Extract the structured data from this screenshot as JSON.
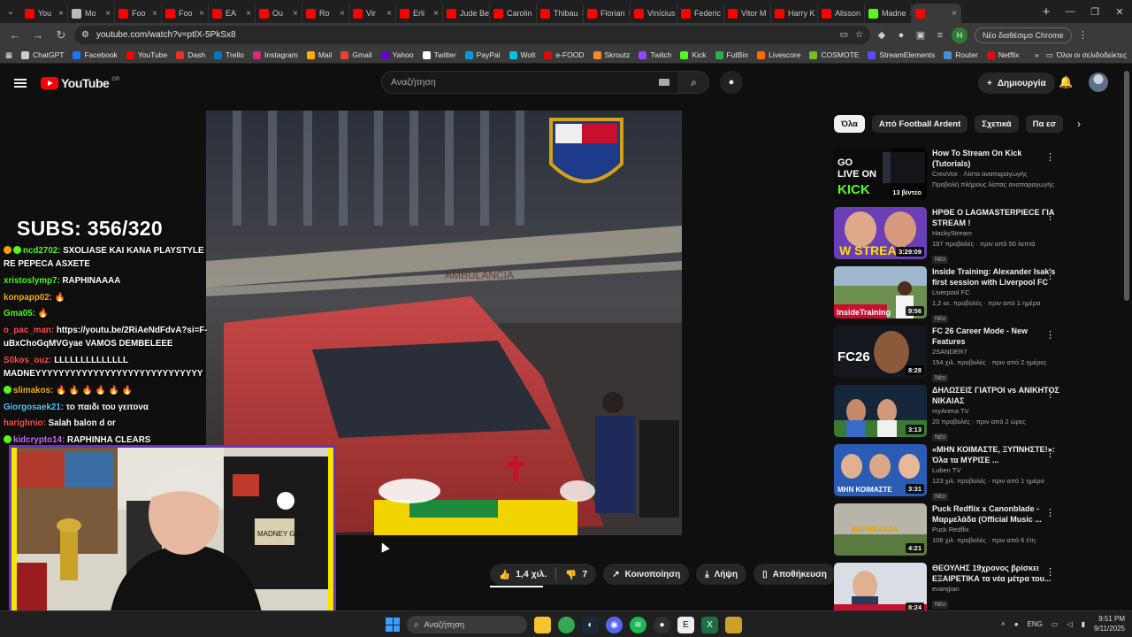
{
  "browser": {
    "tabs": [
      {
        "label": "You",
        "color": "#ff0000",
        "active": false
      },
      {
        "label": "Mo",
        "color": "#bbbbbb",
        "active": false
      },
      {
        "label": "Foo",
        "color": "#ff0000",
        "active": false
      },
      {
        "label": "Foo",
        "color": "#ff0000",
        "active": false
      },
      {
        "label": "EA",
        "color": "#ff0000",
        "active": false
      },
      {
        "label": "Ou",
        "color": "#ff0000",
        "active": false
      },
      {
        "label": "Ro",
        "color": "#ff0000",
        "active": false
      },
      {
        "label": "Vir",
        "color": "#ff0000",
        "active": false
      },
      {
        "label": "Erli",
        "color": "#ff0000",
        "active": false
      },
      {
        "label": "Jude Be",
        "color": "#ff0000",
        "active": false
      },
      {
        "label": "Carolin",
        "color": "#ff0000",
        "active": false
      },
      {
        "label": "Thibau",
        "color": "#ff0000",
        "active": false
      },
      {
        "label": "Florian",
        "color": "#ff0000",
        "active": false
      },
      {
        "label": "Vinícius",
        "color": "#ff0000",
        "active": false
      },
      {
        "label": "Federic",
        "color": "#ff0000",
        "active": false
      },
      {
        "label": "Vitor M",
        "color": "#ff0000",
        "active": false
      },
      {
        "label": "Harry K",
        "color": "#ff0000",
        "active": false
      },
      {
        "label": "Alisson",
        "color": "#ff0000",
        "active": false
      },
      {
        "label": "Madne",
        "color": "#53fc18",
        "active": false
      },
      {
        "label": "",
        "color": "#ff0000",
        "active": true
      }
    ],
    "url": "youtube.com/watch?v=ptlX-5PkSx8",
    "profile_label": "Νέο διαθέσιμο Chrome",
    "bookmarks": [
      {
        "label": "ChatGPT",
        "color": "#cccccc"
      },
      {
        "label": "Facebook",
        "color": "#1877f2"
      },
      {
        "label": "YouTube",
        "color": "#ff0000"
      },
      {
        "label": "Dash",
        "color": "#e5322d"
      },
      {
        "label": "Trello",
        "color": "#0079bf"
      },
      {
        "label": "Instagram",
        "color": "#d62976"
      },
      {
        "label": "Mail",
        "color": "#ffb000"
      },
      {
        "label": "Gmail",
        "color": "#ea4335"
      },
      {
        "label": "Yahoo",
        "color": "#6001d2"
      },
      {
        "label": "Twitter",
        "color": "#ffffff"
      },
      {
        "label": "PayPal",
        "color": "#009cde"
      },
      {
        "label": "Wolt",
        "color": "#00c2e8"
      },
      {
        "label": "e-FOOD",
        "color": "#e30613"
      },
      {
        "label": "Skroutz",
        "color": "#f68b24"
      },
      {
        "label": "Twitch",
        "color": "#9146ff"
      },
      {
        "label": "Kick",
        "color": "#53fc18"
      },
      {
        "label": "FutBin",
        "color": "#2ab24c"
      },
      {
        "label": "Livescore",
        "color": "#ff6b00"
      },
      {
        "label": "COSMOTE",
        "color": "#78be20"
      },
      {
        "label": "StreamElements",
        "color": "#5b4bff"
      },
      {
        "label": "Router",
        "color": "#4a90d9"
      },
      {
        "label": "Netflix",
        "color": "#e50914"
      }
    ],
    "all_bookmarks_label": "Όλοι οι σελιδοδείκτες"
  },
  "youtube": {
    "logo_text": "YouTube",
    "region": "GR",
    "search_placeholder": "Αναζήτηση",
    "create_label": "Δημιουργία"
  },
  "overlay": {
    "subs": "SUBS: 356/320",
    "chat": [
      {
        "user": "ncd2702:",
        "color": "#53fc18",
        "msg": "SXOLIASE KAI KANA PLAYSTYLE RE PEPECA ASXETE",
        "icons": [
          "#f4a300",
          "#53fc18"
        ]
      },
      {
        "user": "xristoslymp7:",
        "color": "#53fc18",
        "msg": "RAPHINAAAA",
        "icons": []
      },
      {
        "user": "konpapp02:",
        "color": "#f4b400",
        "msg": "🔥",
        "icons": []
      },
      {
        "user": "Gma05:",
        "color": "#53fc18",
        "msg": "🔥",
        "icons": []
      },
      {
        "user": "o_pac_man:",
        "color": "#ff4d4d",
        "msg": "https://youtu.be/2RiAeNdFdvA?si=F-uBxChoGqMVGyae VAMOS DEMBELEEE",
        "icons": []
      },
      {
        "user": "S0kos_ouz:",
        "color": "#ff4d4d",
        "msg": "LLLLLLLLLLLLLL MADNEYYYYYYYYYYYYYYYYYYYYYYYYYYYYY",
        "icons": []
      },
      {
        "user": "slimakos:",
        "color": "#f4b400",
        "msg": "🔥 🔥 🔥 🔥 🔥 🔥",
        "icons": [
          "#53fc18"
        ]
      },
      {
        "user": "Giorgosaek21:",
        "color": "#53c8fc",
        "msg": "το παιδι του γειτονα",
        "icons": []
      },
      {
        "user": "harighnio:",
        "color": "#ff4d4d",
        "msg": "Salah balon d or",
        "icons": []
      },
      {
        "user": "kidcrypto14:",
        "color": "#c86bfc",
        "msg": "RAPHINHA CLEARS",
        "icons": [
          "#53fc18"
        ]
      }
    ]
  },
  "actions": {
    "likes": "1,4 χιλ.",
    "dislikes": "7",
    "share": "Κοινοποίηση",
    "download": "Λήψη",
    "save": "Αποθήκευση"
  },
  "chips": [
    "Όλα",
    "Από Football Ardent",
    "Σχετικά",
    "Πα εσ"
  ],
  "recommendations": [
    {
      "title": "How To Stream On Kick (Tutorials)",
      "channel": "CreoVox · Λίστα αναπαραγωγής",
      "meta": "Προβολή πλήρους λίστας αναπαραγωγής",
      "duration": "13 βίντεο",
      "badge": "",
      "thumb": "kick"
    },
    {
      "title": "ΗΡΘΕ Ο LAGMASTERPIECE ΓΙΑ STREAM !",
      "channel": "HackyStream",
      "meta": "197 προβολές · πριν από 50 λεπτά",
      "duration": "3:29:09",
      "badge": "Νέο",
      "thumb": "stream"
    },
    {
      "title": "Inside Training: Alexander Isak's first session with Liverpool FC",
      "channel": "Liverpool FC",
      "meta": "1,2 εκ. προβολές · πριν από 1 ημέρα",
      "duration": "9:56",
      "badge": "Νέο",
      "thumb": "training"
    },
    {
      "title": "FC 26 Career Mode - New Features",
      "channel": "2SANDER7",
      "meta": "154 χιλ. προβολές · πριν από 2 ημέρες",
      "duration": "8:28",
      "badge": "Νέο",
      "thumb": "fc26"
    },
    {
      "title": "ΔΗΛΩΣΕΙΣ ΓΙΑΤΡΟΙ vs ΑΝΙΚΗΤΟΣ ΝΙΚΑΙΑΣ",
      "channel": "myArena TV",
      "meta": "20 προβολές · πριν από 2 ώρες",
      "duration": "3:13",
      "badge": "Νέο",
      "thumb": "pitch"
    },
    {
      "title": "«ΜΗΝ ΚΟΙΜΑΣΤΕ, ΞΥΠΝΗΣΤΕ!»: Όλα τα ΜΥΡΙΣΕ ...",
      "channel": "Luben TV",
      "meta": "123 χιλ. προβολές · πριν από 1 ημέρα",
      "duration": "3:31",
      "badge": "Νέο",
      "thumb": "luben"
    },
    {
      "title": "Puck Redflix x Canonblade - Μαρμελάδα (Official Music ...",
      "channel": "Puck Redflix",
      "meta": "106 χιλ. προβολές · πριν από 6 έτη",
      "duration": "4:21",
      "badge": "",
      "thumb": "music"
    },
    {
      "title": "ΘΕΟΥΛΗΣ 19χρονος βρίσκει ΕΞΑΙΡΕΤΙΚΑ τα νέα μέτρα του...",
      "channel": "evangian",
      "meta": "",
      "duration": "8:24",
      "badge": "Νέο",
      "thumb": "news"
    }
  ],
  "taskbar": {
    "search_placeholder": "Αναζήτηση",
    "lang": "ENG",
    "time": "9:51 PM",
    "date": "9/11/2025"
  }
}
